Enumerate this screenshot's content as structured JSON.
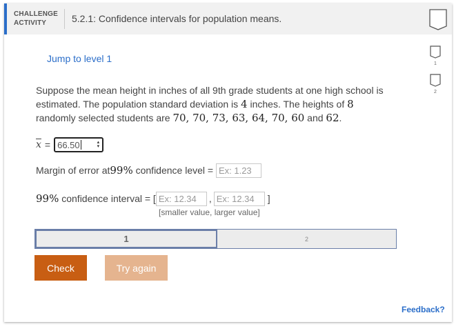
{
  "header": {
    "activity_type_line1": "CHALLENGE",
    "activity_type_line2": "ACTIVITY",
    "title": "5.2.1: Confidence intervals for population means."
  },
  "levels": [
    {
      "number": "1"
    },
    {
      "number": "2"
    }
  ],
  "jump_link": "Jump to level 1",
  "question": {
    "t1": "Suppose the mean height in inches of all 9th grade students at one high school is estimated. The population standard deviation is ",
    "sigma": "4",
    "t2": " inches. The heights of ",
    "n": "8",
    "t3": " randomly selected students are ",
    "values": "70, 70, 73, 63, 64, 70, 60",
    "t4": " and ",
    "last_value": "62",
    "t5": "."
  },
  "xbar": {
    "symbol": "x",
    "equals": "=",
    "value": "66.50"
  },
  "margin": {
    "prefix": "Margin of error at ",
    "level": "99%",
    "suffix": " confidence level = ",
    "placeholder": "Ex: 1.23"
  },
  "ci": {
    "level": "99%",
    "label": " confidence interval = [",
    "placeholder_low": "Ex: 12.34",
    "separator": ",",
    "placeholder_high": "Ex: 12.34",
    "close": "]",
    "hint": "[smaller value, larger value]"
  },
  "progress": {
    "segments": [
      "1",
      "2"
    ],
    "current": "1"
  },
  "buttons": {
    "check": "Check",
    "try_again": "Try again"
  },
  "feedback": "Feedback?",
  "colors": {
    "accent_blue": "#2b6ec9",
    "check_orange": "#c85e13",
    "try_again_orange": "#e5b48f"
  }
}
